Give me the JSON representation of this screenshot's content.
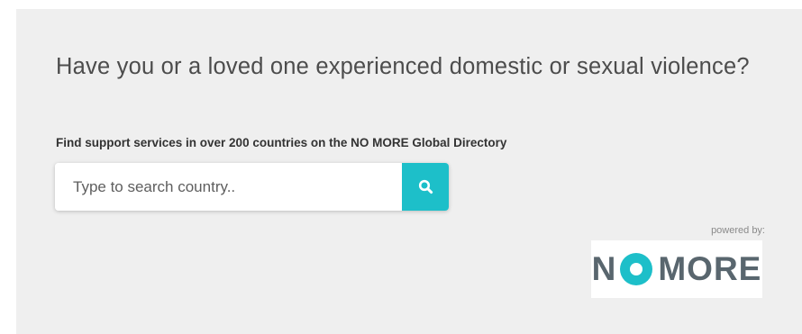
{
  "promo": {
    "headline": "Have you or a loved one experienced domestic or sexual violence?",
    "subtitle": "Find support services in over 200 countries on the NO MORE Global Directory"
  },
  "search": {
    "placeholder": "Type to search country..",
    "value": "",
    "button_icon": "search-icon"
  },
  "branding": {
    "powered_by": "powered by:",
    "logo_text_left": "N",
    "logo_text_right": "MORE",
    "logo_dot_icon": "circle-dot-icon"
  },
  "colors": {
    "panel_background": "#efefef",
    "accent": "#1dbfc9",
    "logo_text": "#59666e",
    "headline_text": "#4c4c4c"
  }
}
